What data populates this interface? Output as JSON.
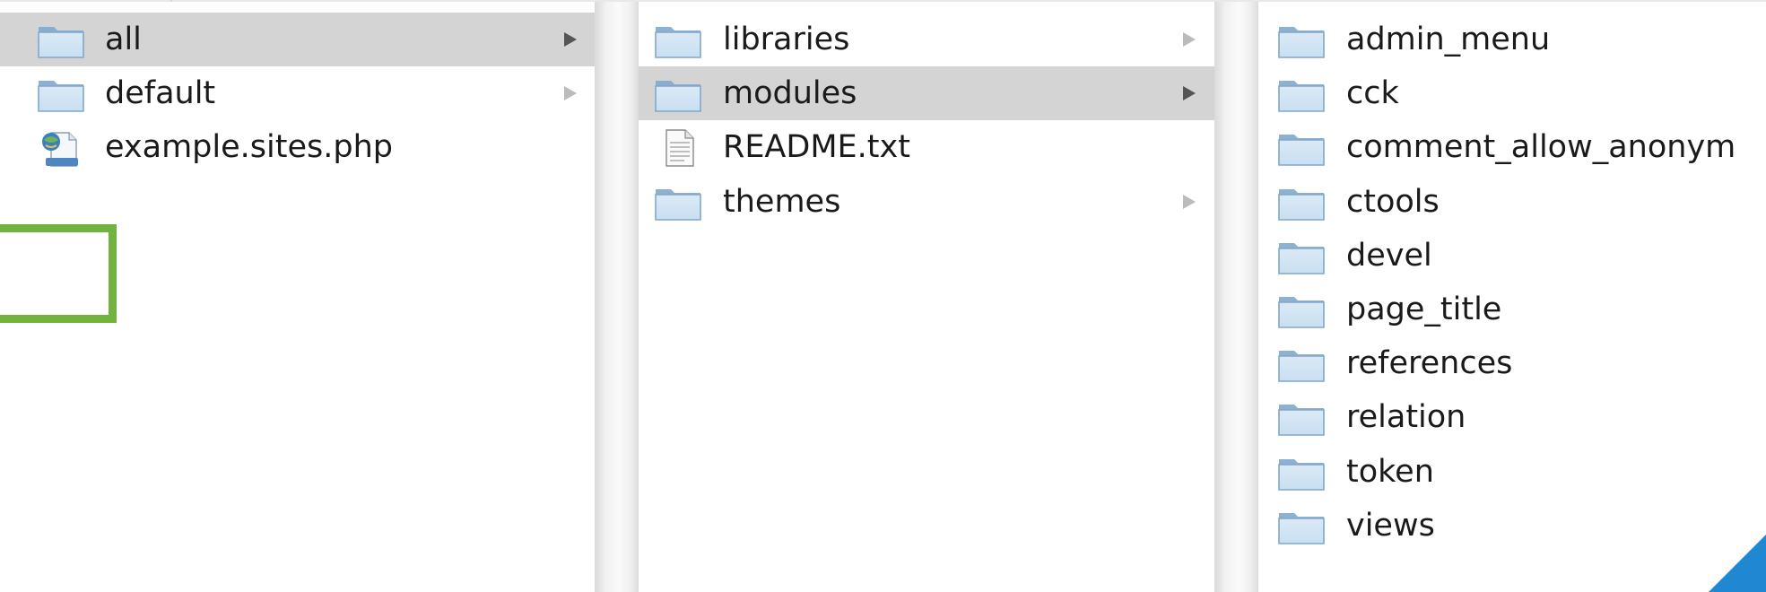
{
  "columns": [
    {
      "items": [
        {
          "name": "all",
          "kind": "folder",
          "icon": "folder-icon",
          "selected": true,
          "has_children": true,
          "arrow": "active"
        },
        {
          "name": "default",
          "kind": "folder",
          "icon": "folder-icon",
          "selected": false,
          "has_children": true,
          "arrow": "inactive"
        },
        {
          "name": "example.sites.php",
          "kind": "file",
          "icon": "php-file-icon",
          "selected": false,
          "has_children": false
        }
      ]
    },
    {
      "items": [
        {
          "name": "libraries",
          "kind": "folder",
          "icon": "folder-icon",
          "selected": false,
          "has_children": true,
          "arrow": "inactive"
        },
        {
          "name": "modules",
          "kind": "folder",
          "icon": "folder-icon",
          "selected": true,
          "has_children": true,
          "arrow": "active"
        },
        {
          "name": "README.txt",
          "kind": "file",
          "icon": "text-file-icon",
          "selected": false,
          "has_children": false
        },
        {
          "name": "themes",
          "kind": "folder",
          "icon": "folder-icon",
          "selected": false,
          "has_children": true,
          "arrow": "inactive"
        }
      ]
    },
    {
      "items": [
        {
          "name": "admin_menu",
          "kind": "folder",
          "icon": "folder-icon",
          "selected": false
        },
        {
          "name": "cck",
          "kind": "folder",
          "icon": "folder-icon",
          "selected": false
        },
        {
          "name": "comment_allow_anonym",
          "kind": "folder",
          "icon": "folder-icon",
          "selected": false
        },
        {
          "name": "ctools",
          "kind": "folder",
          "icon": "folder-icon",
          "selected": false
        },
        {
          "name": "devel",
          "kind": "folder",
          "icon": "folder-icon",
          "selected": false
        },
        {
          "name": "page_title",
          "kind": "folder",
          "icon": "folder-icon",
          "selected": false
        },
        {
          "name": "references",
          "kind": "folder",
          "icon": "folder-icon",
          "selected": false
        },
        {
          "name": "relation",
          "kind": "folder",
          "icon": "folder-icon",
          "selected": false
        },
        {
          "name": "token",
          "kind": "folder",
          "icon": "folder-icon",
          "selected": false
        },
        {
          "name": "views",
          "kind": "folder",
          "icon": "folder-icon",
          "selected": false
        }
      ]
    }
  ],
  "colors": {
    "selection": "#d4d4d4",
    "text": "#1a1a1a",
    "folder_light": "#c9dff1",
    "folder_dark": "#7fa8cc",
    "arrow_active": "#555555",
    "arrow_inactive": "#bbbbbb",
    "highlight": "#72b33f",
    "corner_accent": "#1f88d2"
  },
  "annotations": {
    "highlight_box": {
      "color": "#72b33f"
    },
    "corner_triangle": {
      "color": "#1f88d2"
    }
  }
}
